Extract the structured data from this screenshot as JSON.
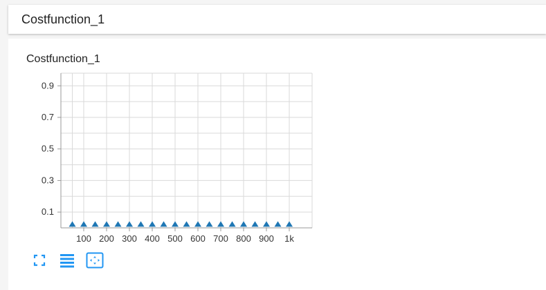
{
  "header": {
    "title": "Costfunction_1"
  },
  "card": {
    "title": "Costfunction_1"
  },
  "colors": {
    "marker": "#1f77b4",
    "grid": "#d9d9d9",
    "axis": "#999999",
    "toolbar_icon": "#2196f3"
  },
  "toolbar": {
    "icons": [
      "fit-screen-icon",
      "list-icon",
      "zoom-selection-icon"
    ]
  },
  "chart_data": {
    "type": "scatter",
    "marker": "triangle",
    "x": [
      50,
      100,
      150,
      200,
      250,
      300,
      350,
      400,
      450,
      500,
      550,
      600,
      650,
      700,
      750,
      800,
      850,
      900,
      950,
      1000
    ],
    "y": [
      0.007,
      0.007,
      0.007,
      0.007,
      0.007,
      0.007,
      0.007,
      0.007,
      0.007,
      0.007,
      0.007,
      0.007,
      0.007,
      0.007,
      0.007,
      0.007,
      0.007,
      0.007,
      0.007,
      0.007
    ],
    "xlim": [
      0,
      1100
    ],
    "ylim": [
      0,
      0.98
    ],
    "xticks": [
      100,
      200,
      300,
      400,
      500,
      600,
      700,
      800,
      900,
      1000
    ],
    "xtick_labels": [
      "100",
      "200",
      "300",
      "400",
      "500",
      "600",
      "700",
      "800",
      "900",
      "1k"
    ],
    "yticks": [
      0.1,
      0.3,
      0.5,
      0.7,
      0.9
    ],
    "ytick_labels": [
      "0.1",
      "0.3",
      "0.5",
      "0.7",
      "0.9"
    ],
    "ygrid": [
      0.1,
      0.2,
      0.3,
      0.4,
      0.5,
      0.6,
      0.7,
      0.8,
      0.9
    ],
    "grid": true
  }
}
